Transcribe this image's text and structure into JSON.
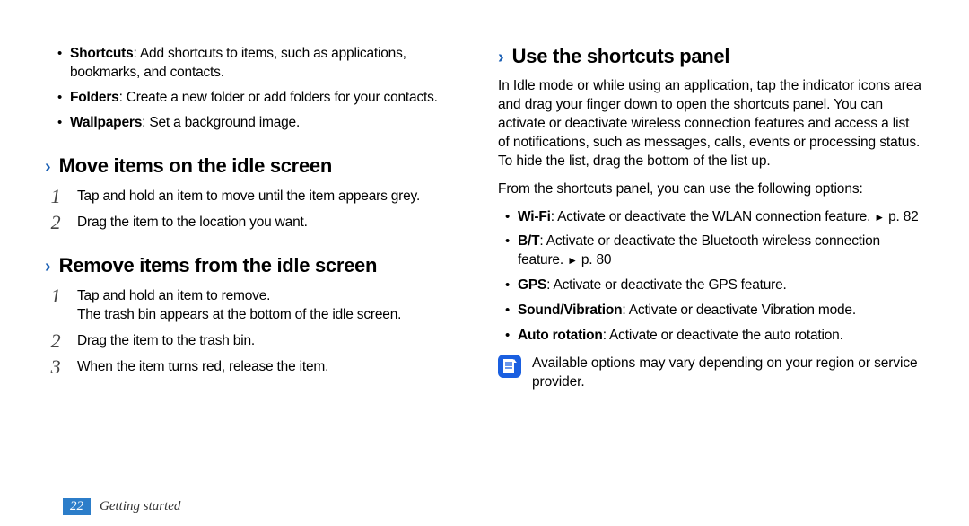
{
  "left": {
    "intro_bullets": [
      {
        "term": "Shortcuts",
        "desc": ": Add shortcuts to items, such as applications, bookmarks, and contacts."
      },
      {
        "term": "Folders",
        "desc": ": Create a new folder or add folders for your contacts."
      },
      {
        "term": "Wallpapers",
        "desc": ": Set a background image."
      }
    ],
    "heading_move": "Move items on the idle screen",
    "move_steps": [
      "Tap and hold an item to move until the item appears grey.",
      "Drag the item to the location you want."
    ],
    "heading_remove": "Remove items from the idle screen",
    "remove_steps": [
      {
        "main": "Tap and hold an item to remove.",
        "sub": "The trash bin appears at the bottom of the idle screen."
      },
      {
        "main": "Drag the item to the trash bin."
      },
      {
        "main": "When the item turns red, release the item."
      }
    ]
  },
  "right": {
    "heading_use": "Use the shortcuts panel",
    "para1": "In Idle mode or while using an application, tap the indicator icons area and drag your finger down to open the shortcuts panel. You can activate or deactivate wireless connection features and access a list of notifications, such as messages, calls, events or processing status. To hide the list, drag the bottom of the list up.",
    "para2": "From the shortcuts panel, you can use the following options:",
    "bullets": [
      {
        "term": "Wi-Fi",
        "desc": ": Activate or deactivate the WLAN connection feature. ",
        "ref": "p. 82"
      },
      {
        "term": "B/T",
        "desc": ": Activate or deactivate the Bluetooth wireless connection feature. ",
        "ref": "p. 80"
      },
      {
        "term": "GPS",
        "desc": ": Activate or deactivate the GPS feature."
      },
      {
        "term": "Sound/Vibration",
        "desc": ": Activate or deactivate Vibration mode."
      },
      {
        "term": "Auto rotation",
        "desc": ": Activate or deactivate the auto rotation."
      }
    ],
    "note": "Available options may vary depending on your region or service provider."
  },
  "footer": {
    "page": "22",
    "chapter": "Getting started"
  },
  "icons": {
    "chevron": "›",
    "triangle": "►"
  }
}
